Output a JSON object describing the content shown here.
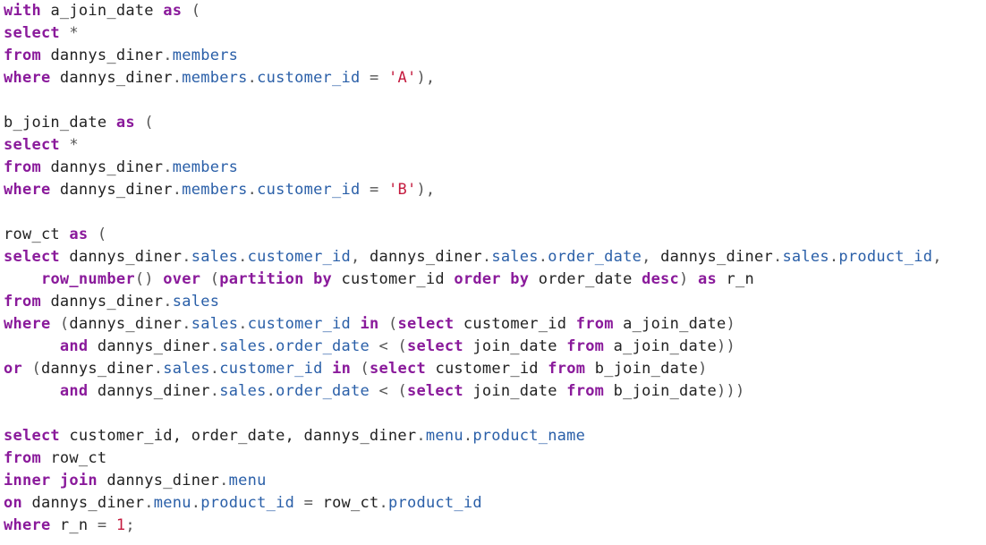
{
  "editor": {
    "language": "sql",
    "colors": {
      "keyword": "#8a1a9b",
      "identifier": "#222222",
      "property": "#2a5fa8",
      "string": "#c41a3e",
      "number": "#c41a3e",
      "punctuation": "#555555",
      "background": "#ffffff"
    },
    "lines": [
      [
        {
          "t": "kw",
          "v": "with"
        },
        {
          "t": "id",
          "v": " a_join_date "
        },
        {
          "t": "kw",
          "v": "as"
        },
        {
          "t": "punct",
          "v": " ("
        }
      ],
      [
        {
          "t": "kw",
          "v": "select"
        },
        {
          "t": "punct",
          "v": " *"
        }
      ],
      [
        {
          "t": "kw",
          "v": "from"
        },
        {
          "t": "id",
          "v": " dannys_diner"
        },
        {
          "t": "punct",
          "v": "."
        },
        {
          "t": "prop",
          "v": "members"
        }
      ],
      [
        {
          "t": "kw",
          "v": "where"
        },
        {
          "t": "id",
          "v": " dannys_diner"
        },
        {
          "t": "punct",
          "v": "."
        },
        {
          "t": "prop",
          "v": "members"
        },
        {
          "t": "punct",
          "v": "."
        },
        {
          "t": "prop",
          "v": "customer_id"
        },
        {
          "t": "punct",
          "v": " = "
        },
        {
          "t": "str",
          "v": "'A'"
        },
        {
          "t": "punct",
          "v": "),"
        }
      ],
      [],
      [
        {
          "t": "id",
          "v": "b_join_date "
        },
        {
          "t": "kw",
          "v": "as"
        },
        {
          "t": "punct",
          "v": " ("
        }
      ],
      [
        {
          "t": "kw",
          "v": "select"
        },
        {
          "t": "punct",
          "v": " *"
        }
      ],
      [
        {
          "t": "kw",
          "v": "from"
        },
        {
          "t": "id",
          "v": " dannys_diner"
        },
        {
          "t": "punct",
          "v": "."
        },
        {
          "t": "prop",
          "v": "members"
        }
      ],
      [
        {
          "t": "kw",
          "v": "where"
        },
        {
          "t": "id",
          "v": " dannys_diner"
        },
        {
          "t": "punct",
          "v": "."
        },
        {
          "t": "prop",
          "v": "members"
        },
        {
          "t": "punct",
          "v": "."
        },
        {
          "t": "prop",
          "v": "customer_id"
        },
        {
          "t": "punct",
          "v": " = "
        },
        {
          "t": "str",
          "v": "'B'"
        },
        {
          "t": "punct",
          "v": "),"
        }
      ],
      [],
      [
        {
          "t": "id",
          "v": "row_ct "
        },
        {
          "t": "kw",
          "v": "as"
        },
        {
          "t": "punct",
          "v": " ("
        }
      ],
      [
        {
          "t": "kw",
          "v": "select"
        },
        {
          "t": "id",
          "v": " dannys_diner"
        },
        {
          "t": "punct",
          "v": "."
        },
        {
          "t": "prop",
          "v": "sales"
        },
        {
          "t": "punct",
          "v": "."
        },
        {
          "t": "prop",
          "v": "customer_id"
        },
        {
          "t": "punct",
          "v": ", "
        },
        {
          "t": "id",
          "v": "dannys_diner"
        },
        {
          "t": "punct",
          "v": "."
        },
        {
          "t": "prop",
          "v": "sales"
        },
        {
          "t": "punct",
          "v": "."
        },
        {
          "t": "prop",
          "v": "order_date"
        },
        {
          "t": "punct",
          "v": ", "
        },
        {
          "t": "id",
          "v": "dannys_diner"
        },
        {
          "t": "punct",
          "v": "."
        },
        {
          "t": "prop",
          "v": "sales"
        },
        {
          "t": "punct",
          "v": "."
        },
        {
          "t": "prop",
          "v": "product_id"
        },
        {
          "t": "punct",
          "v": ","
        }
      ],
      [
        {
          "t": "id",
          "v": "    "
        },
        {
          "t": "kw",
          "v": "row_number"
        },
        {
          "t": "punct",
          "v": "() "
        },
        {
          "t": "kw",
          "v": "over"
        },
        {
          "t": "punct",
          "v": " ("
        },
        {
          "t": "kw",
          "v": "partition by"
        },
        {
          "t": "id",
          "v": " customer_id "
        },
        {
          "t": "kw",
          "v": "order by"
        },
        {
          "t": "id",
          "v": " order_date "
        },
        {
          "t": "kw",
          "v": "desc"
        },
        {
          "t": "punct",
          "v": ") "
        },
        {
          "t": "kw",
          "v": "as"
        },
        {
          "t": "id",
          "v": " r_n"
        }
      ],
      [
        {
          "t": "kw",
          "v": "from"
        },
        {
          "t": "id",
          "v": " dannys_diner"
        },
        {
          "t": "punct",
          "v": "."
        },
        {
          "t": "prop",
          "v": "sales"
        }
      ],
      [
        {
          "t": "kw",
          "v": "where"
        },
        {
          "t": "punct",
          "v": " ("
        },
        {
          "t": "id",
          "v": "dannys_diner"
        },
        {
          "t": "punct",
          "v": "."
        },
        {
          "t": "prop",
          "v": "sales"
        },
        {
          "t": "punct",
          "v": "."
        },
        {
          "t": "prop",
          "v": "customer_id"
        },
        {
          "t": "id",
          "v": " "
        },
        {
          "t": "kw",
          "v": "in"
        },
        {
          "t": "punct",
          "v": " ("
        },
        {
          "t": "kw",
          "v": "select"
        },
        {
          "t": "id",
          "v": " customer_id "
        },
        {
          "t": "kw",
          "v": "from"
        },
        {
          "t": "id",
          "v": " a_join_date"
        },
        {
          "t": "punct",
          "v": ")"
        }
      ],
      [
        {
          "t": "id",
          "v": "      "
        },
        {
          "t": "kw",
          "v": "and"
        },
        {
          "t": "id",
          "v": " dannys_diner"
        },
        {
          "t": "punct",
          "v": "."
        },
        {
          "t": "prop",
          "v": "sales"
        },
        {
          "t": "punct",
          "v": "."
        },
        {
          "t": "prop",
          "v": "order_date"
        },
        {
          "t": "punct",
          "v": " < ("
        },
        {
          "t": "kw",
          "v": "select"
        },
        {
          "t": "id",
          "v": " join_date "
        },
        {
          "t": "kw",
          "v": "from"
        },
        {
          "t": "id",
          "v": " a_join_date"
        },
        {
          "t": "punct",
          "v": "))"
        }
      ],
      [
        {
          "t": "kw",
          "v": "or"
        },
        {
          "t": "punct",
          "v": " ("
        },
        {
          "t": "id",
          "v": "dannys_diner"
        },
        {
          "t": "punct",
          "v": "."
        },
        {
          "t": "prop",
          "v": "sales"
        },
        {
          "t": "punct",
          "v": "."
        },
        {
          "t": "prop",
          "v": "customer_id"
        },
        {
          "t": "id",
          "v": " "
        },
        {
          "t": "kw",
          "v": "in"
        },
        {
          "t": "punct",
          "v": " ("
        },
        {
          "t": "kw",
          "v": "select"
        },
        {
          "t": "id",
          "v": " customer_id "
        },
        {
          "t": "kw",
          "v": "from"
        },
        {
          "t": "id",
          "v": " b_join_date"
        },
        {
          "t": "punct",
          "v": ")"
        }
      ],
      [
        {
          "t": "id",
          "v": "      "
        },
        {
          "t": "kw",
          "v": "and"
        },
        {
          "t": "id",
          "v": " dannys_diner"
        },
        {
          "t": "punct",
          "v": "."
        },
        {
          "t": "prop",
          "v": "sales"
        },
        {
          "t": "punct",
          "v": "."
        },
        {
          "t": "prop",
          "v": "order_date"
        },
        {
          "t": "punct",
          "v": " < ("
        },
        {
          "t": "kw",
          "v": "select"
        },
        {
          "t": "id",
          "v": " join_date "
        },
        {
          "t": "kw",
          "v": "from"
        },
        {
          "t": "id",
          "v": " b_join_date"
        },
        {
          "t": "punct",
          "v": ")))"
        }
      ],
      [],
      [
        {
          "t": "kw",
          "v": "select"
        },
        {
          "t": "id",
          "v": " customer_id, order_date, dannys_diner"
        },
        {
          "t": "punct",
          "v": "."
        },
        {
          "t": "prop",
          "v": "menu"
        },
        {
          "t": "punct",
          "v": "."
        },
        {
          "t": "prop",
          "v": "product_name"
        }
      ],
      [
        {
          "t": "kw",
          "v": "from"
        },
        {
          "t": "id",
          "v": " row_ct"
        }
      ],
      [
        {
          "t": "kw",
          "v": "inner join"
        },
        {
          "t": "id",
          "v": " dannys_diner"
        },
        {
          "t": "punct",
          "v": "."
        },
        {
          "t": "prop",
          "v": "menu"
        }
      ],
      [
        {
          "t": "kw",
          "v": "on"
        },
        {
          "t": "id",
          "v": " dannys_diner"
        },
        {
          "t": "punct",
          "v": "."
        },
        {
          "t": "prop",
          "v": "menu"
        },
        {
          "t": "punct",
          "v": "."
        },
        {
          "t": "prop",
          "v": "product_id"
        },
        {
          "t": "punct",
          "v": " = "
        },
        {
          "t": "id",
          "v": "row_ct"
        },
        {
          "t": "punct",
          "v": "."
        },
        {
          "t": "prop",
          "v": "product_id"
        }
      ],
      [
        {
          "t": "kw",
          "v": "where"
        },
        {
          "t": "id",
          "v": " r_n "
        },
        {
          "t": "punct",
          "v": "= "
        },
        {
          "t": "num",
          "v": "1"
        },
        {
          "t": "punct",
          "v": ";"
        }
      ]
    ]
  }
}
